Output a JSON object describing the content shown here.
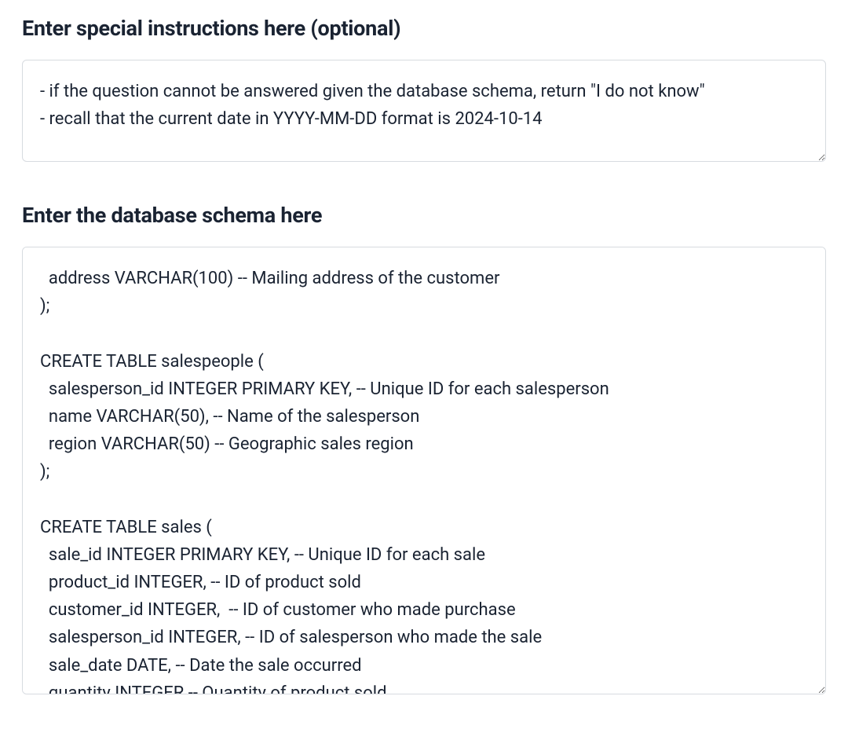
{
  "instructions_section": {
    "heading": "Enter special instructions here (optional)",
    "value": "- if the question cannot be answered given the database schema, return \"I do not know\"\n- recall that the current date in YYYY-MM-DD format is 2024-10-14"
  },
  "schema_section": {
    "heading": "Enter the database schema here",
    "value": "  address VARCHAR(100) -- Mailing address of the customer\n);\n\nCREATE TABLE salespeople (\n  salesperson_id INTEGER PRIMARY KEY, -- Unique ID for each salesperson\n  name VARCHAR(50), -- Name of the salesperson\n  region VARCHAR(50) -- Geographic sales region\n);\n\nCREATE TABLE sales (\n  sale_id INTEGER PRIMARY KEY, -- Unique ID for each sale\n  product_id INTEGER, -- ID of product sold\n  customer_id INTEGER,  -- ID of customer who made purchase\n  salesperson_id INTEGER, -- ID of salesperson who made the sale\n  sale_date DATE, -- Date the sale occurred\n  quantity INTEGER -- Quantity of product sold\n);"
  }
}
